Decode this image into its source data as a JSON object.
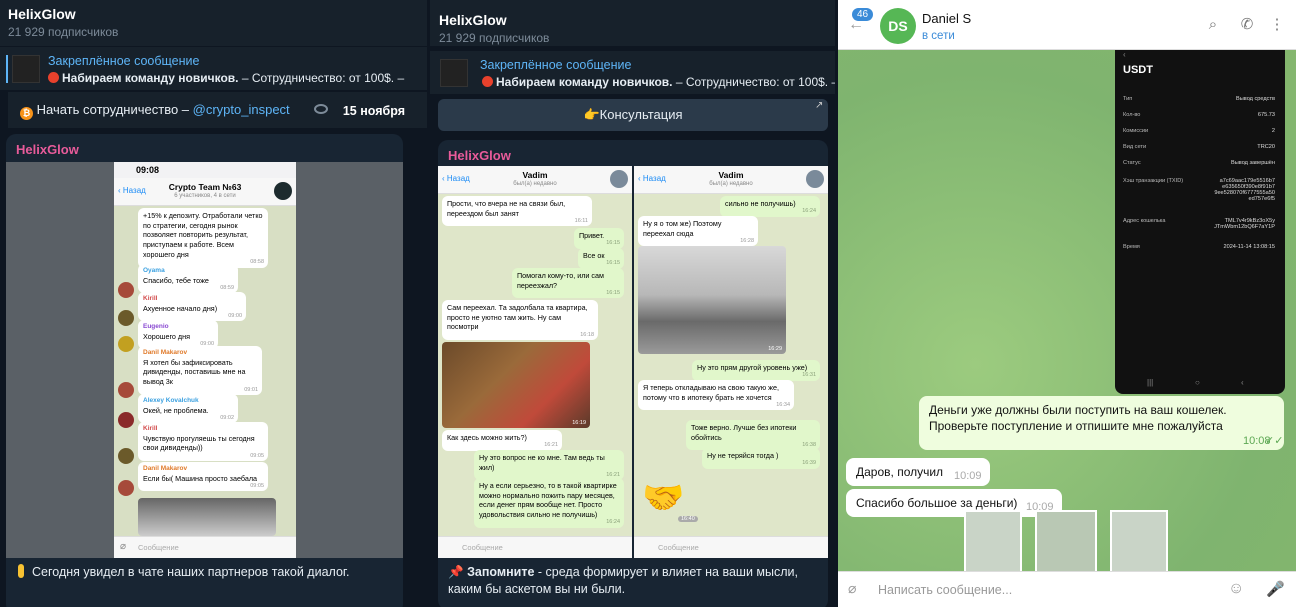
{
  "channel1": {
    "title": "HelixGlow",
    "subscribers": "21 929 подписчиков",
    "pinned_title": "Закреплённое сообщение",
    "pinned_bold": "Набираем команду новичков.",
    "pinned_rest": " – Сотрудничество: от 100$. –",
    "cta_text": "Начать сотрудничество – ",
    "cta_link": "@crypto_inspect",
    "date": "15 ноября",
    "post_author": "HelixGlow",
    "caption": "Сегодня увидел в чате наших партнеров такой диалог.",
    "phone": {
      "time": "09:08",
      "back": "Назад",
      "chat_name": "Crypto Team №63",
      "chat_sub": "6 участников, 4 в сети",
      "input_placeholder": "Сообщение",
      "messages": [
        {
          "name": "",
          "text": "+15% к депозиту. Отработали четко по стратегии, сегодня рынок позволяет повторить результат, приступаем к работе. Всем хорошего дня",
          "time": "08:58"
        },
        {
          "name": "Oyama",
          "text": "Спасибо, тебе тоже",
          "time": "08:59"
        },
        {
          "name": "Kirill",
          "text": "Ахуенное начало дня)",
          "time": "09:00"
        },
        {
          "name": "Eugenio",
          "text": "Хорошего дня",
          "time": "09:00"
        },
        {
          "name": "Danil Makarov",
          "text": "Я хотел бы зафиксировать дивиденды, поставишь мне на вывод 3к",
          "time": "09:01"
        },
        {
          "name": "Alexey Kovalchuk",
          "text": "Окей, не проблема.",
          "time": "09:02"
        },
        {
          "name": "Kirill",
          "text": "Чувствую прогуляешь ты сегодня свои дивиденды))",
          "time": "09:05"
        },
        {
          "name": "Danil Makarov",
          "text": "Если бы( Машина просто заебала",
          "time": "09:05"
        }
      ]
    }
  },
  "channel2": {
    "title": "HelixGlow",
    "subscribers": "21 929 подписчиков",
    "pinned_title": "Закреплённое сообщение",
    "pinned_bold": "Набираем команду новичков.",
    "pinned_rest": " – Сотрудничество: от 100$. –",
    "consult_button": "👉Консультация",
    "post_author": "HelixGlow",
    "caption_bold": "Запомните",
    "caption_rest": " - среда формирует и влияет на ваши мысли, каким бы аскетом вы ни были.",
    "phoneA": {
      "back": "Назад",
      "chat_name": "Vadim",
      "chat_sub": "был(а) недавно",
      "input_placeholder": "Сообщение",
      "messages": [
        {
          "dir": "in",
          "text": "Прости, что вчера не на связи был, переездом был занят",
          "time": "16:11"
        },
        {
          "dir": "out",
          "text": "Привет.",
          "time": "16:15"
        },
        {
          "dir": "out",
          "text": "Все ок",
          "time": "16:15"
        },
        {
          "dir": "out",
          "text": "Помогал кому-то, или сам переезжал?",
          "time": "16:15"
        },
        {
          "dir": "in",
          "text": "Сам переехал. Та задолбала та квартира, просто не уютно там жить. Ну сам посмотри",
          "time": "16:18"
        },
        {
          "dir": "in",
          "text": "Как здесь можно жить?)",
          "time": "16:21"
        },
        {
          "dir": "out",
          "text": "Ну это вопрос не ко мне. Там ведь ты жил)",
          "time": "16:21"
        },
        {
          "dir": "out",
          "text": "Ну а если серьезно, то в такой квартирке можно нормально пожить пару месяцев, если денег прям вообще нет. Просто удовольствия сильно не получишь)",
          "time": "16:24"
        }
      ],
      "photo_time": "16:19"
    },
    "phoneB": {
      "back": "Назад",
      "chat_name": "Vadim",
      "chat_sub": "был(а) недавно",
      "input_placeholder": "Сообщение",
      "messages": [
        {
          "dir": "out",
          "text": "сильно не получишь)",
          "time": "16:24"
        },
        {
          "dir": "in",
          "text": "Ну я о том же) Поэтому переехал сюда",
          "time": "16:28"
        },
        {
          "dir": "out",
          "text": "Ну это прям другой уровень уже)",
          "time": "16:31"
        },
        {
          "dir": "in",
          "text": "Я теперь откладываю на свою такую же, потому что в ипотеку брать не хочется",
          "time": "16:34"
        },
        {
          "dir": "out",
          "text": "Тоже верно. Лучше без ипотеки обойтись",
          "time": "16:38"
        },
        {
          "dir": "out",
          "text": "Ну не теряйся тогда )",
          "time": "16:39"
        }
      ],
      "photo_time": "16:29",
      "sticker_time": "16:40"
    }
  },
  "chat3": {
    "badge": "46",
    "avatar_initials": "DS",
    "name": "Daniel S",
    "status": "в сети",
    "input_placeholder": "Написать сообщение...",
    "receipt": {
      "title": "USDT",
      "rows": [
        {
          "k": "Тип",
          "v": "Вывод средств"
        },
        {
          "k": "Кол-во",
          "v": "675.73"
        },
        {
          "k": "Комиссии",
          "v": "2"
        },
        {
          "k": "Вид сети",
          "v": "TRC20"
        },
        {
          "k": "Статус",
          "v": "Вывод завершён"
        },
        {
          "k": "Хэш транзакции (TXID)",
          "v": "a7c69aac179e5516b7 e635650f390e8f91b7 9ee528070f6777555a50 ed757e6f5"
        },
        {
          "k": "Адрес кошелька",
          "v": "TML7v4r9kBz3oX5y JTmWbm12bQ6F7aY1P"
        },
        {
          "k": "Время",
          "v": "2024-11-14 13:08:15"
        }
      ]
    },
    "messages": [
      {
        "dir": "out",
        "text": "Деньги уже должны были поступить на ваш кошелек. Проверьте поступление и отпишите мне пожалуйста",
        "time": "10:08"
      },
      {
        "dir": "in",
        "text": "Даров, получил",
        "time": "10:09"
      },
      {
        "dir": "in",
        "text": "Спасибо большое за деньги)",
        "time": "10:09"
      }
    ],
    "colors": {
      "accent": "#3a8bd8",
      "avatar": "#56b755",
      "wallpaper": "#8fbf7a"
    }
  }
}
